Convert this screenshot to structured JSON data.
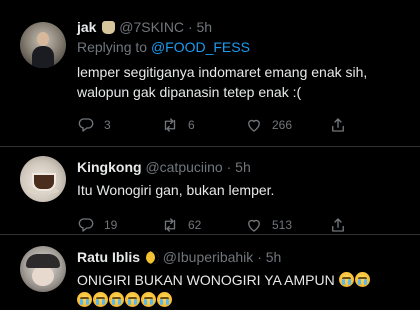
{
  "tweets": [
    {
      "name": "jak",
      "name_emoji": "bag-emoji",
      "handle": "@7SKINC",
      "time": "5h",
      "reply_prefix": "Replying to",
      "reply_mention": "@FOOD_FESS",
      "text_line1": "lemper segitiganya indomaret emang enak sih,",
      "text_line2": "walopun gak dipanasin tetep enak :(",
      "replies": "3",
      "retweets": "6",
      "likes": "266"
    },
    {
      "name": "Kingkong",
      "handle": "@catpuciino",
      "time": "5h",
      "text_line1": "Itu Wonogiri gan, bukan lemper.",
      "replies": "19",
      "retweets": "62",
      "likes": "513"
    },
    {
      "name": "Ratu Iblis",
      "name_emoji": "crescent-moon-emoji",
      "handle": "@Ibuperibahik",
      "time": "5h",
      "text_line1": "ONIGIRI BUKAN WONOGIRI YA AMPUN",
      "emoji": "loudly-crying-face"
    }
  ],
  "separator": "·",
  "colors": {
    "background": "#000000",
    "text": "#e7e9ea",
    "muted": "#71767b",
    "link": "#1d9bf0",
    "divider": "#2f3336"
  }
}
